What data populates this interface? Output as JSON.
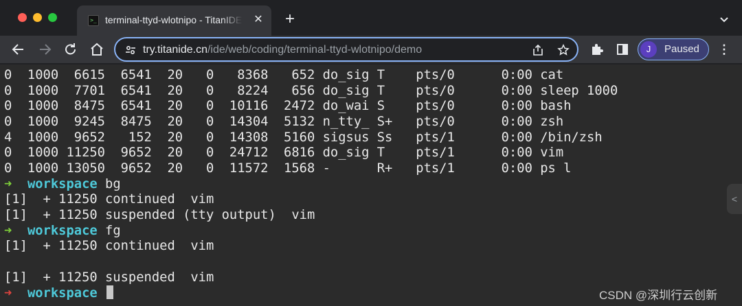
{
  "window": {
    "tab": {
      "favicon": ">_",
      "title": "terminal-ttyd-wlotnipo - TitanIDE",
      "close_icon": "close-icon"
    },
    "new_tab_label": "+"
  },
  "toolbar": {
    "url_host": "try.titanide.cn",
    "url_path": "/ide/web/coding/terminal-ttyd-wlotnipo/demo",
    "profile": {
      "initial": "J",
      "status": "Paused"
    },
    "accent": "#8ab4f8"
  },
  "terminal": {
    "process_rows": [
      "0  1000  6615  6541  20   0   8368   652 do_sig T    pts/0      0:00 cat",
      "0  1000  7701  6541  20   0   8224   656 do_sig T    pts/0      0:00 sleep 1000",
      "0  1000  8475  6541  20   0  10116  2472 do_wai S    pts/0      0:00 bash",
      "0  1000  9245  8475  20   0  14304  5132 n_tty_ S+   pts/0      0:00 zsh",
      "4  1000  9652   152  20   0  14308  5160 sigsus Ss   pts/1      0:00 /bin/zsh",
      "0  1000 11250  9652  20   0  24712  6816 do_sig T    pts/1      0:00 vim",
      "0  1000 13050  9652  20   0  11572  1568 -      R+   pts/1      0:00 ps l"
    ],
    "prompt_dir": "workspace",
    "prompt_arrow": "➜",
    "cmd_bg": "bg",
    "job_continued_1": "[1]  + 11250 continued  vim",
    "job_suspended_tty": "[1]  + 11250 suspended (tty output)  vim",
    "cmd_fg": "fg",
    "job_continued_2": "[1]  + 11250 continued  vim",
    "job_suspended": "[1]  + 11250 suspended  vim",
    "colors": {
      "prompt_ok": "#7ecf3a",
      "prompt_fail": "#e0443e",
      "prompt_dir": "#4ec9d9"
    }
  },
  "watermark": "CSDN @深圳行云创新"
}
